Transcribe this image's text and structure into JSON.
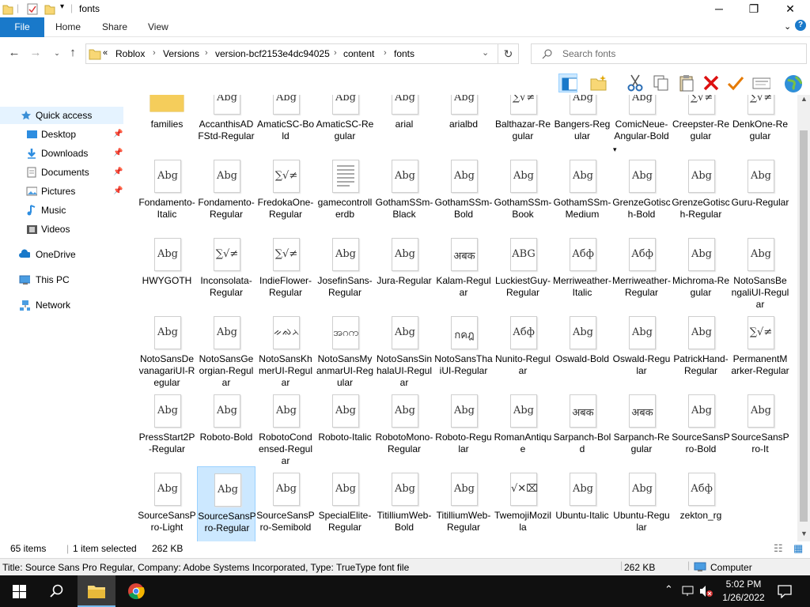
{
  "window": {
    "title": "fonts"
  },
  "ribbon": {
    "tabs": [
      "File",
      "Home",
      "Share",
      "View"
    ]
  },
  "address": {
    "crumbs": [
      "Roblox",
      "Versions",
      "version-bcf2153e4dc94025",
      "content",
      "fonts"
    ],
    "overflow": "«"
  },
  "search": {
    "placeholder": "Search fonts"
  },
  "nav": {
    "quick_access": "Quick access",
    "items": [
      "Desktop",
      "Downloads",
      "Documents",
      "Pictures",
      "Music",
      "Videos"
    ],
    "onedrive": "OneDrive",
    "thispc": "This PC",
    "network": "Network"
  },
  "files": [
    {
      "name": "families",
      "glyph": ""
    },
    {
      "name": "AccanthisADFStd-Regular",
      "glyph": "Abg"
    },
    {
      "name": "AmaticSC-Bold",
      "glyph": "Abg"
    },
    {
      "name": "AmaticSC-Regular",
      "glyph": "Abg"
    },
    {
      "name": "arial",
      "glyph": "Abg"
    },
    {
      "name": "arialbd",
      "glyph": "Abg"
    },
    {
      "name": "Balthazar-Regular",
      "glyph": "∑√≠"
    },
    {
      "name": "Bangers-Regular",
      "glyph": "Abg"
    },
    {
      "name": "ComicNeue-Angular-Bold",
      "glyph": "Abg"
    },
    {
      "name": "Creepster-Regular",
      "glyph": "∑√≠"
    },
    {
      "name": "DenkOne-Regular",
      "glyph": "∑√≠"
    },
    {
      "name": "Fondamento-Italic",
      "glyph": "Abg"
    },
    {
      "name": "Fondamento-Regular",
      "glyph": "Abg"
    },
    {
      "name": "FredokaOne-Regular",
      "glyph": "∑√≠"
    },
    {
      "name": "gamecontrollerdb",
      "glyph": ""
    },
    {
      "name": "GothamSSm-Black",
      "glyph": "Abg"
    },
    {
      "name": "GothamSSm-Bold",
      "glyph": "Abg"
    },
    {
      "name": "GothamSSm-Book",
      "glyph": "Abg"
    },
    {
      "name": "GothamSSm-Medium",
      "glyph": "Abg"
    },
    {
      "name": "GrenzeGotisch-Bold",
      "glyph": "Abg"
    },
    {
      "name": "GrenzeGotisch-Regular",
      "glyph": "Abg"
    },
    {
      "name": "Guru-Regular",
      "glyph": "Abg"
    },
    {
      "name": "HWYGOTH",
      "glyph": "Abg"
    },
    {
      "name": "Inconsolata-Regular",
      "glyph": "∑√≠"
    },
    {
      "name": "IndieFlower-Regular",
      "glyph": "∑√≠"
    },
    {
      "name": "JosefinSans-Regular",
      "glyph": "Abg"
    },
    {
      "name": "Jura-Regular",
      "glyph": "Abg"
    },
    {
      "name": "Kalam-Regular",
      "glyph": "अबक"
    },
    {
      "name": "LuckiestGuy-Regular",
      "glyph": "ABG"
    },
    {
      "name": "Merriweather-Italic",
      "glyph": "Абф"
    },
    {
      "name": "Merriweather-Regular",
      "glyph": "Абф"
    },
    {
      "name": "Michroma-Regular",
      "glyph": "Abg"
    },
    {
      "name": "NotoSansBengaliUI-Regular",
      "glyph": "Abg"
    },
    {
      "name": "NotoSansDevanagariUI-Regular",
      "glyph": "Abg"
    },
    {
      "name": "NotoSansGeorgian-Regular",
      "glyph": "Abg"
    },
    {
      "name": "NotoSansKhmerUI-Regular",
      "glyph": "ᨀᨁᨂ"
    },
    {
      "name": "NotoSansMyanmarUI-Regular",
      "glyph": "အဂက"
    },
    {
      "name": "NotoSansSinhalaUI-Regular",
      "glyph": "Abg"
    },
    {
      "name": "NotoSansThaiUI-Regular",
      "glyph": "กคฎ"
    },
    {
      "name": "Nunito-Regular",
      "glyph": "Абф"
    },
    {
      "name": "Oswald-Bold",
      "glyph": "Abg"
    },
    {
      "name": "Oswald-Regular",
      "glyph": "Abg"
    },
    {
      "name": "PatrickHand-Regular",
      "glyph": "Abg"
    },
    {
      "name": "PermanentMarker-Regular",
      "glyph": "∑√≠"
    },
    {
      "name": "PressStart2P-Regular",
      "glyph": "Abg"
    },
    {
      "name": "Roboto-Bold",
      "glyph": "Abg"
    },
    {
      "name": "RobotoCondensed-Regular",
      "glyph": "Abg"
    },
    {
      "name": "Roboto-Italic",
      "glyph": "Abg"
    },
    {
      "name": "RobotoMono-Regular",
      "glyph": "Abg"
    },
    {
      "name": "Roboto-Regular",
      "glyph": "Abg"
    },
    {
      "name": "RomanAntique",
      "glyph": "Abg"
    },
    {
      "name": "Sarpanch-Bold",
      "glyph": "अबक"
    },
    {
      "name": "Sarpanch-Regular",
      "glyph": "अबक"
    },
    {
      "name": "SourceSansPro-Bold",
      "glyph": "Abg"
    },
    {
      "name": "SourceSansPro-It",
      "glyph": "Abg"
    },
    {
      "name": "SourceSansPro-Light",
      "glyph": "Abg"
    },
    {
      "name": "SourceSansPro-Regular",
      "glyph": "Abg",
      "selected": true
    },
    {
      "name": "SourceSansPro-Semibold",
      "glyph": "Abg"
    },
    {
      "name": "SpecialElite-Regular",
      "glyph": "Abg"
    },
    {
      "name": "TitilliumWeb-Bold",
      "glyph": "Abg"
    },
    {
      "name": "TitilliumWeb-Regular",
      "glyph": "Abg"
    },
    {
      "name": "TwemojiMozilla",
      "glyph": "√✕⌧"
    },
    {
      "name": "Ubuntu-Italic",
      "glyph": "Abg"
    },
    {
      "name": "Ubuntu-Regular",
      "glyph": "Abg"
    },
    {
      "name": "zekton_rg",
      "glyph": "Абф"
    }
  ],
  "status": {
    "items": "65 items",
    "selected": "1 item selected",
    "size": "262 KB"
  },
  "info": {
    "text": "Title: Source Sans Pro Regular, Company: Adobe Systems Incorporated, Type: TrueType font file",
    "size": "262 KB",
    "location": "Computer"
  },
  "taskbar": {
    "time": "5:02 PM",
    "date": "1/26/2022"
  },
  "colors": {
    "accent": "#1979ca",
    "selection": "#cce8ff",
    "taskbar": "#101010"
  }
}
